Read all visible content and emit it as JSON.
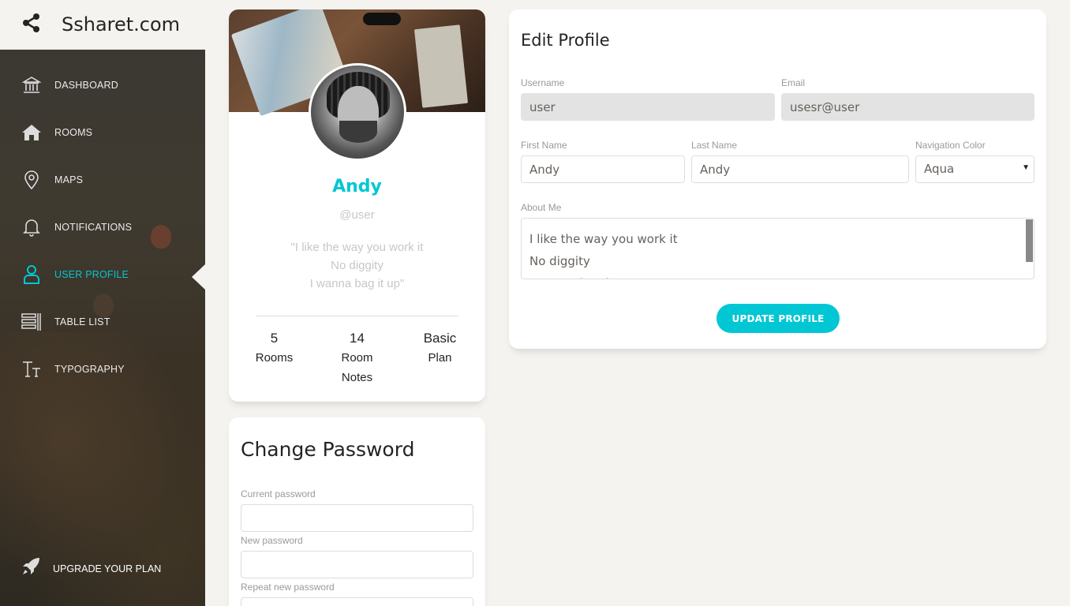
{
  "app": {
    "brand": "Ssharet.com"
  },
  "sidebar": {
    "items": [
      {
        "label": "DASHBOARD",
        "icon": "bank-icon"
      },
      {
        "label": "ROOMS",
        "icon": "home-icon"
      },
      {
        "label": "MAPS",
        "icon": "map-pin-icon"
      },
      {
        "label": "NOTIFICATIONS",
        "icon": "bell-icon"
      },
      {
        "label": "USER PROFILE",
        "icon": "user-icon",
        "active": true
      },
      {
        "label": "TABLE LIST",
        "icon": "table-list-icon"
      },
      {
        "label": "TYPOGRAPHY",
        "icon": "typography-icon"
      }
    ],
    "upgrade_label": "UPGRADE YOUR PLAN",
    "upgrade_icon": "rocket-icon"
  },
  "profile": {
    "name": "Andy",
    "username": "@user",
    "quote": [
      "\"I like the way you work it",
      "No diggity",
      "I wanna bag it up\""
    ],
    "stats": [
      {
        "value": "5",
        "label": [
          "Rooms"
        ]
      },
      {
        "value": "14",
        "label": [
          "Room",
          "Notes"
        ]
      },
      {
        "value": "Basic",
        "label": [
          "Plan"
        ]
      }
    ]
  },
  "change_password": {
    "title": "Change Password",
    "current_label": "Current password",
    "new_label": "New password",
    "repeat_label": "Repeat new password"
  },
  "edit_profile": {
    "title": "Edit Profile",
    "username_label": "Username",
    "username_value": "user",
    "email_label": "Email",
    "email_value": "usesr@user",
    "first_name_label": "First Name",
    "first_name_value": "Andy",
    "last_name_label": "Last Name",
    "last_name_value": "Andy",
    "nav_color_label": "Navigation Color",
    "nav_color_value": "Aqua",
    "about_label": "About Me",
    "about_lines": [
      "I like the way you work it",
      "No diggity",
      "I wanna bag it up"
    ],
    "submit_label": "UPDATE PROFILE"
  },
  "colors": {
    "accent": "#00c7d3",
    "background": "#f4f3ef",
    "sidebar_text": "#ffffff"
  }
}
